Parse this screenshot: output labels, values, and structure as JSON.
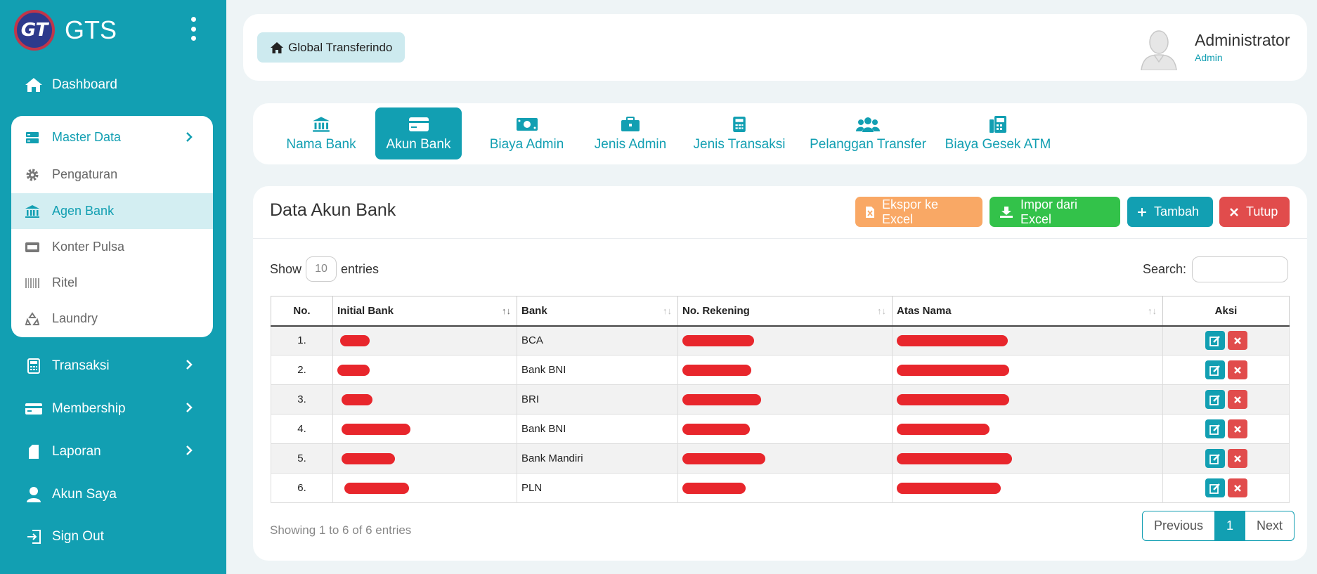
{
  "brand": {
    "logo_text": "GT",
    "name": "GTS"
  },
  "sidebar": {
    "items": [
      {
        "label": "Dashboard",
        "icon": "home-icon"
      },
      {
        "label": "Transaksi",
        "icon": "calculator-icon"
      },
      {
        "label": "Membership",
        "icon": "card-icon"
      },
      {
        "label": "Laporan",
        "icon": "book-icon"
      },
      {
        "label": "Akun Saya",
        "icon": "user-icon"
      },
      {
        "label": "Sign Out",
        "icon": "sign-out-icon"
      }
    ],
    "submenu": {
      "head": "Master Data",
      "items": [
        {
          "label": "Pengaturan",
          "icon": "gear-icon"
        },
        {
          "label": "Agen Bank",
          "icon": "bank-icon"
        },
        {
          "label": "Konter Pulsa",
          "icon": "hdd-icon"
        },
        {
          "label": "Ritel",
          "icon": "barcode-icon"
        },
        {
          "label": "Laundry",
          "icon": "recycle-icon"
        }
      ]
    }
  },
  "topbar": {
    "home_label": "Global Transferindo",
    "user_name": "Administrator",
    "user_role": "Admin"
  },
  "tabs": [
    {
      "label": "Nama Bank",
      "icon": "bank-icon"
    },
    {
      "label": "Akun Bank",
      "icon": "credit-card-icon",
      "active": true
    },
    {
      "label": "Biaya Admin",
      "icon": "money-icon"
    },
    {
      "label": "Jenis Admin",
      "icon": "briefcase-icon"
    },
    {
      "label": "Jenis Transaksi",
      "icon": "calculator-icon"
    },
    {
      "label": "Pelanggan Transfer",
      "icon": "users-icon"
    },
    {
      "label": "Biaya Gesek ATM",
      "icon": "fax-icon"
    }
  ],
  "card": {
    "title": "Data Akun Bank",
    "buttons": {
      "export": "Ekspor ke Excel",
      "import": "Impor dari Excel",
      "add": "Tambah",
      "close": "Tutup"
    },
    "show_label": "Show",
    "entries_label": "entries",
    "page_size": "10",
    "search_label": "Search:",
    "search_value": "",
    "columns": [
      "No.",
      "Initial Bank",
      "Bank",
      "No. Rekening",
      "Atas Nama",
      "Aksi"
    ],
    "rows": [
      {
        "no": "1.",
        "bank": "BCA"
      },
      {
        "no": "2.",
        "bank": "Bank BNI"
      },
      {
        "no": "3.",
        "bank": "BRI"
      },
      {
        "no": "4.",
        "bank": "Bank BNI"
      },
      {
        "no": "5.",
        "bank": "Bank Mandiri"
      },
      {
        "no": "6.",
        "bank": "PLN"
      }
    ],
    "showing_text": "Showing 1 to 6 of 6 entries",
    "pagination": {
      "previous": "Previous",
      "current": "1",
      "next": "Next"
    }
  },
  "colors": {
    "primary": "#129fb2",
    "orange": "#f9a865",
    "green": "#33c24a",
    "red": "#e14c4c",
    "redaction": "#e8262c"
  }
}
